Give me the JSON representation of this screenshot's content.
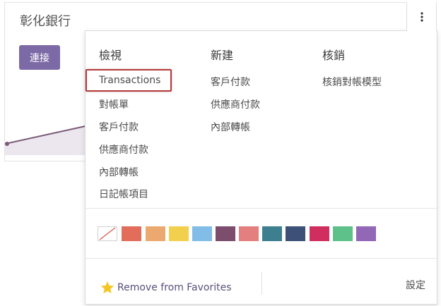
{
  "card": {
    "title": "彰化銀行",
    "connect_label": "連接"
  },
  "menu": {
    "columns": [
      {
        "header": "檢視",
        "items": [
          "Transactions",
          "對帳單",
          "客戶付款",
          "供應商付款",
          "內部轉帳",
          "日記帳項目"
        ]
      },
      {
        "header": "新建",
        "items": [
          "客戶付款",
          "供應商付款",
          "內部轉帳"
        ]
      },
      {
        "header": "核銷",
        "items": [
          "核銷對帳模型"
        ]
      }
    ],
    "colors": [
      "none",
      "#e16d5a",
      "#eca96f",
      "#f2d04e",
      "#82bde8",
      "#7c4d6d",
      "#e3807f",
      "#3d7f8f",
      "#3d5178",
      "#d02e5f",
      "#5ec18a",
      "#9267b6"
    ],
    "favorite_label": "Remove from Favorites",
    "settings_label": "設定"
  },
  "icons": {
    "kebab": "vertical-ellipsis-icon",
    "star": "star-icon",
    "no_color": "slash-icon"
  },
  "accent_color": "#7c6aa6",
  "highlight_color": "#b33a3a"
}
